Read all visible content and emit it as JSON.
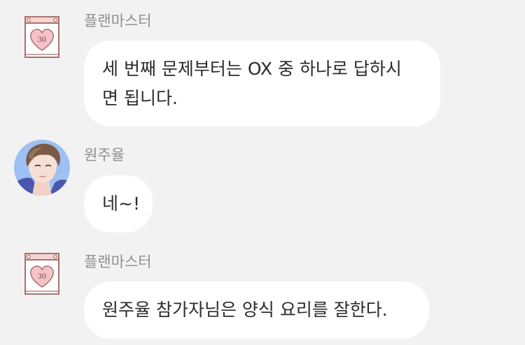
{
  "messages": [
    {
      "sender": "플랜마스터",
      "avatar_icon": "calendar-heart-icon",
      "avatar_badge": "30",
      "lines": [
        "세 번째 문제부터는 OX 중 하나로 답하시",
        "면 됩니다."
      ]
    },
    {
      "sender": "원주율",
      "avatar_icon": "user-portrait",
      "lines": [
        "네~!"
      ]
    },
    {
      "sender": "플랜마스터",
      "avatar_icon": "calendar-heart-icon",
      "avatar_badge": "30",
      "lines": [
        "원주율 참가자님은 양식 요리를 잘한다."
      ]
    }
  ],
  "colors": {
    "background": "#f2f2f2",
    "bubble": "#ffffff",
    "sender_name": "#8f8f8f",
    "message_text": "#2b2b2b",
    "calendar_frame": "#a9726c",
    "heart_fill": "#f4c2c8",
    "portrait_background": "#9ec0f2"
  }
}
